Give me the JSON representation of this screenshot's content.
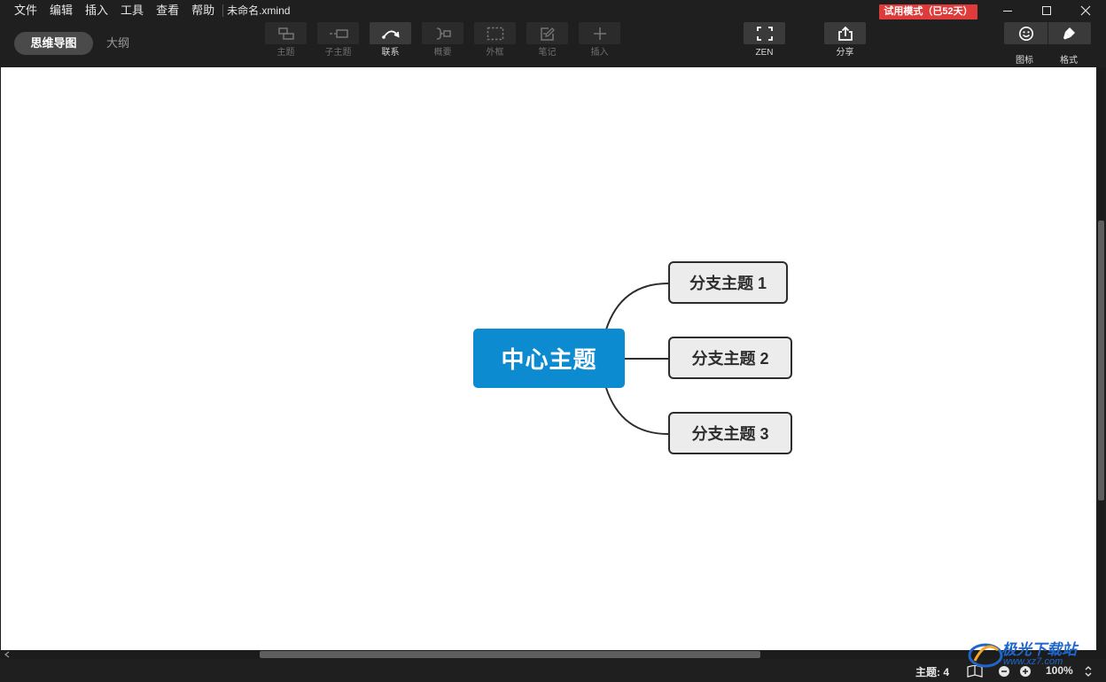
{
  "menu": {
    "items": [
      "文件",
      "编辑",
      "插入",
      "工具",
      "查看",
      "帮助"
    ],
    "filename": "未命名.xmind"
  },
  "trial_badge": "试用模式（已52天）",
  "window_controls": [
    "minimize-icon",
    "maximize-icon",
    "close-icon"
  ],
  "toolbar": {
    "view_mindmap": "思维导图",
    "view_outline": "大纲",
    "tools": [
      {
        "label": "主题",
        "icon": "topic-icon",
        "enabled": false
      },
      {
        "label": "子主题",
        "icon": "subtopic-icon",
        "enabled": false
      },
      {
        "label": "联系",
        "icon": "relationship-icon",
        "enabled": true
      },
      {
        "label": "概要",
        "icon": "summary-icon",
        "enabled": false
      },
      {
        "label": "外框",
        "icon": "boundary-icon",
        "enabled": false
      },
      {
        "label": "笔记",
        "icon": "note-icon",
        "enabled": false
      },
      {
        "label": "插入",
        "icon": "plus-icon",
        "enabled": false
      }
    ],
    "zen_label": "ZEN",
    "share_label": "分享",
    "icon_panel_label": "图标",
    "format_panel_label": "格式"
  },
  "mindmap": {
    "central": "中心主题",
    "branches": [
      "分支主题 1",
      "分支主题 2",
      "分支主题 3"
    ],
    "colors": {
      "central": "#0d8bd1",
      "branch_fill": "#ececec",
      "line": "#2d2d2d"
    }
  },
  "status": {
    "topic_count": "主题: 4",
    "zoom": "100%"
  },
  "watermark": {
    "text": "极光下载站",
    "url": "www.xz7.com"
  },
  "colors": {
    "trial_badge": "#e03b3b",
    "chrome": "#1f1f1f"
  }
}
